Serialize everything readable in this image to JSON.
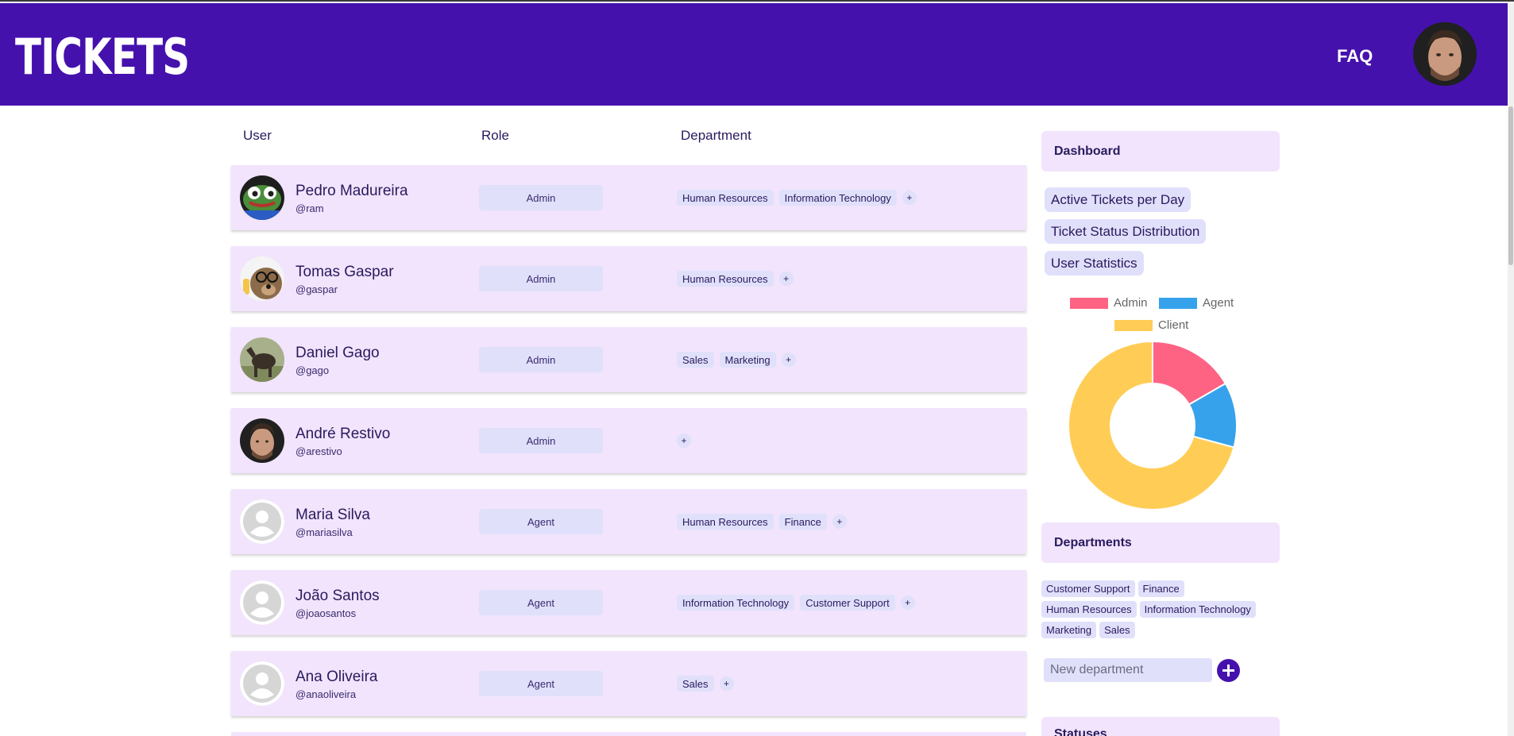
{
  "app": {
    "logo": "TICKETS",
    "faq_label": "FAQ",
    "header_avatar": "user-avatar-photo"
  },
  "table": {
    "columns": {
      "user": "User",
      "role": "Role",
      "department": "Department"
    },
    "add_symbol": "+",
    "rows": [
      {
        "name": "Pedro Madureira",
        "handle": "@ram",
        "role": "Admin",
        "departments": [
          "Human Resources",
          "Information Technology"
        ],
        "avatar": "frog-avatar"
      },
      {
        "name": "Tomas Gaspar",
        "handle": "@gaspar",
        "role": "Admin",
        "departments": [
          "Human Resources"
        ],
        "avatar": "dog-avatar"
      },
      {
        "name": "Daniel Gago",
        "handle": "@gago",
        "role": "Admin",
        "departments": [
          "Sales",
          "Marketing"
        ],
        "avatar": "horse-avatar"
      },
      {
        "name": "André Restivo",
        "handle": "@arestivo",
        "role": "Admin",
        "departments": [],
        "avatar": "photo-avatar"
      },
      {
        "name": "Maria Silva",
        "handle": "@mariasilva",
        "role": "Agent",
        "departments": [
          "Human Resources",
          "Finance"
        ],
        "avatar": "default-avatar"
      },
      {
        "name": "João Santos",
        "handle": "@joaosantos",
        "role": "Agent",
        "departments": [
          "Information Technology",
          "Customer Support"
        ],
        "avatar": "default-avatar"
      },
      {
        "name": "Ana Oliveira",
        "handle": "@anaoliveira",
        "role": "Agent",
        "departments": [
          "Sales"
        ],
        "avatar": "default-avatar"
      }
    ]
  },
  "dashboard": {
    "title": "Dashboard",
    "buttons": [
      "Active Tickets per Day",
      "Ticket Status Distribution",
      "User Statistics"
    ]
  },
  "chart_data": {
    "type": "pie",
    "categories": [
      "Admin",
      "Agent",
      "Client"
    ],
    "values": [
      4,
      3,
      17
    ],
    "colors": [
      "#ff6384",
      "#36a2eb",
      "#ffcd56"
    ],
    "legend": "top"
  },
  "departments": {
    "title": "Departments",
    "list": [
      "Customer Support",
      "Finance",
      "Human Resources",
      "Information Technology",
      "Marketing",
      "Sales"
    ],
    "new_placeholder": "New department"
  },
  "statuses": {
    "title": "Statuses"
  }
}
